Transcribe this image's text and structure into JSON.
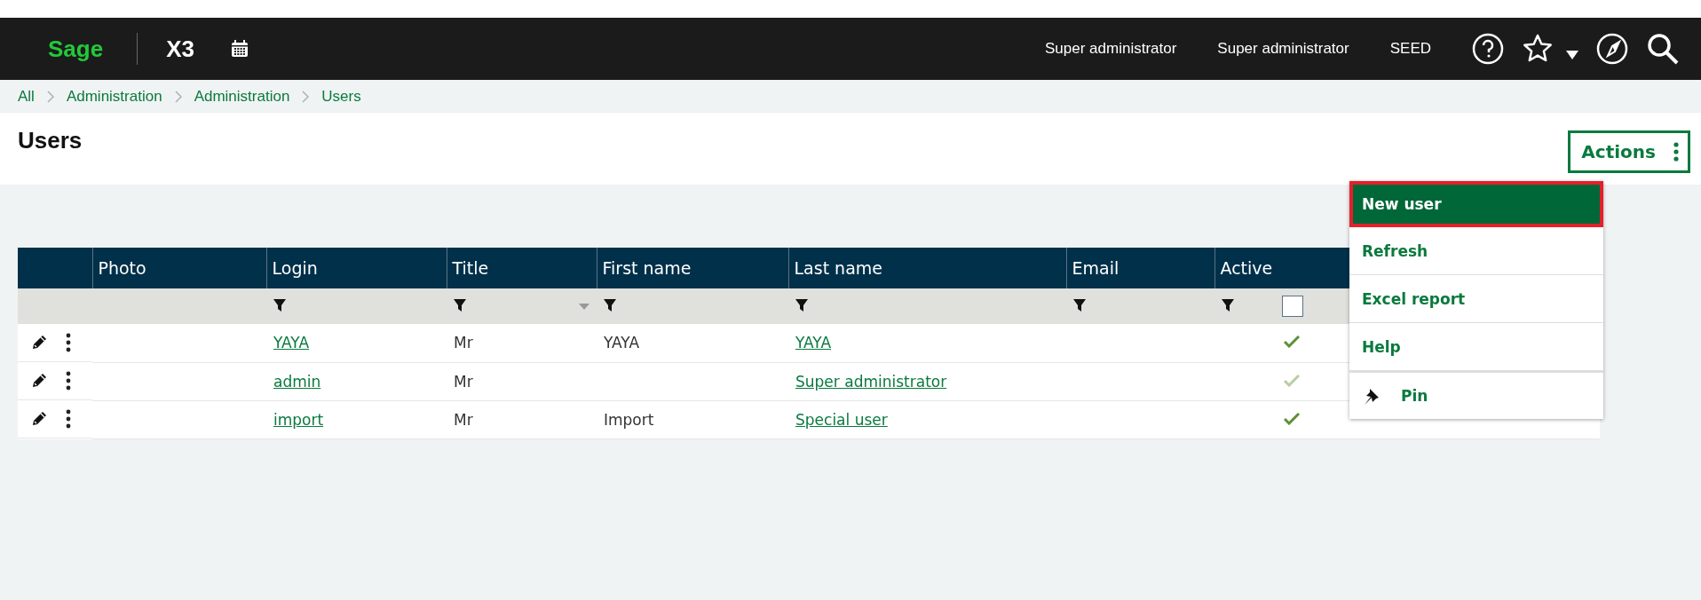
{
  "topbar": {
    "logo": "Sage",
    "product": "X3",
    "user": "Super administrator",
    "role": "Super administrator",
    "folder": "SEED"
  },
  "breadcrumb": [
    "All",
    "Administration",
    "Administration",
    "Users"
  ],
  "page": {
    "title": "Users",
    "actions_label": "Actions"
  },
  "table": {
    "columns": [
      "Photo",
      "Login",
      "Title",
      "First name",
      "Last name",
      "Email",
      "Active"
    ],
    "filters": [
      false,
      true,
      true,
      true,
      true,
      true,
      true
    ],
    "active_filter_checked": false,
    "rows": [
      {
        "login": "YAYA",
        "title": "Mr",
        "first_name": "YAYA",
        "last_name": "YAYA",
        "active": true,
        "dimmed": false
      },
      {
        "login": "admin",
        "title": "Mr",
        "first_name": "",
        "last_name": "Super administrator",
        "active": true,
        "dimmed": true
      },
      {
        "login": "import",
        "title": "Mr",
        "first_name": "Import",
        "last_name": "Special user",
        "active": true,
        "dimmed": false
      }
    ]
  },
  "menu": [
    {
      "label": "New user",
      "selected": true,
      "kind": "text"
    },
    {
      "label": "Refresh",
      "selected": false,
      "kind": "text"
    },
    {
      "label": "Excel report",
      "selected": false,
      "kind": "text"
    },
    {
      "label": "Help",
      "selected": false,
      "kind": "text"
    },
    {
      "label": "Pin",
      "selected": false,
      "kind": "pin"
    }
  ]
}
